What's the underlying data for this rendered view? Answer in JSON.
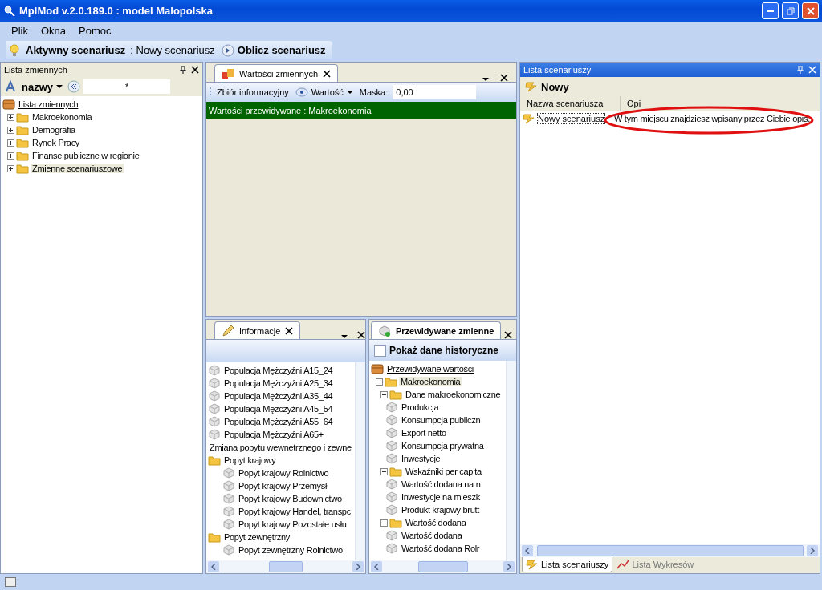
{
  "window": {
    "title": "MplMod v.2.0.189.0 : model Malopolska"
  },
  "menu": [
    "Plik",
    "Okna",
    "Pomoc"
  ],
  "toolbar": {
    "active_label": "Aktywny scenariusz",
    "active_value": ": Nowy scenariusz",
    "compute_button": "Oblicz scenariusz"
  },
  "variables_panel": {
    "title": "Lista zmiennych",
    "sort_button": "nazwy",
    "filter": "*",
    "tree": [
      {
        "kind": "root",
        "label": "Lista zmiennych",
        "selected": false,
        "children": [
          {
            "kind": "folder",
            "label": "Makroekonomia",
            "expanded": false,
            "selected": false
          },
          {
            "kind": "folder",
            "label": "Demografia",
            "expanded": false,
            "selected": false
          },
          {
            "kind": "folder",
            "label": "Rynek Pracy",
            "expanded": false,
            "selected": false
          },
          {
            "kind": "folder",
            "label": "Finanse publiczne w regionie",
            "expanded": false,
            "selected": false
          },
          {
            "kind": "folder",
            "label": "Zmienne scenariuszowe",
            "expanded": false,
            "selected": true
          }
        ]
      }
    ]
  },
  "values_panel": {
    "tabs": [
      {
        "label": "Wartości zmiennych",
        "selected": true
      }
    ],
    "set_label": "Zbiór informacyjny",
    "value_button": "Wartość",
    "mask_label": "Maska:",
    "mask_value": "0,00",
    "header": "Wartości przewidywane : Makroekonomia"
  },
  "info_panel": {
    "tabs": [
      {
        "label": "Informacje",
        "selected": true
      }
    ],
    "tree": [
      {
        "kind": "leaf",
        "label": "Populacja Mężczyźni A15_24",
        "selected": false
      },
      {
        "kind": "leaf",
        "label": "Populacja Mężczyźni A25_34",
        "selected": false
      },
      {
        "kind": "leaf",
        "label": "Populacja Mężczyźni A35_44",
        "selected": false
      },
      {
        "kind": "leaf",
        "label": "Populacja Mężczyźni A45_54",
        "selected": false
      },
      {
        "kind": "leaf",
        "label": "Populacja Mężczyźni A55_64",
        "selected": false
      },
      {
        "kind": "leaf",
        "label": "Populacja Mężczyźni A65+",
        "selected": false
      },
      {
        "kind": "text",
        "label": "Zmiana popytu wewnetrznego i zewne",
        "selected": false
      },
      {
        "kind": "folder",
        "label": "Popyt krajowy",
        "selected": false,
        "children": [
          {
            "kind": "leaf",
            "label": "Popyt krajowy Rolnictwo",
            "selected": false
          },
          {
            "kind": "leaf",
            "label": "Popyt krajowy Przemysł",
            "selected": false
          },
          {
            "kind": "leaf",
            "label": "Popyt krajowy Budownictwo",
            "selected": false
          },
          {
            "kind": "leaf",
            "label": "Popyt krajowy Handel, transpc",
            "selected": false
          },
          {
            "kind": "leaf",
            "label": "Popyt krajowy Pozostałe usłu",
            "selected": false
          }
        ]
      },
      {
        "kind": "folder",
        "label": "Popyt zewnętrzny",
        "selected": false,
        "children": [
          {
            "kind": "leaf",
            "label": "Popyt zewnętrzny Rolnictwo",
            "selected": false
          }
        ]
      }
    ]
  },
  "forecast_panel": {
    "tabs": [
      {
        "label": "Przewidywane zmienne",
        "selected": true
      }
    ],
    "history_checkbox": {
      "label": "Pokaż dane historyczne",
      "checked": false
    },
    "tree": [
      {
        "kind": "root",
        "label": "Przewidywane wartości",
        "selected": false,
        "children": [
          {
            "kind": "folder",
            "label": "Makroekonomia",
            "expanded": true,
            "selected": true,
            "children": [
              {
                "kind": "folder",
                "label": "Dane makroekonomiczne",
                "expanded": true,
                "selected": false,
                "children": [
                  {
                    "kind": "leaf",
                    "label": "Produkcja",
                    "selected": false
                  },
                  {
                    "kind": "leaf",
                    "label": "Konsumpcja publiczn",
                    "selected": false
                  },
                  {
                    "kind": "leaf",
                    "label": "Export netto",
                    "selected": false
                  },
                  {
                    "kind": "leaf",
                    "label": "Konsumpcja prywatna",
                    "selected": false
                  },
                  {
                    "kind": "leaf",
                    "label": "Inwestycje",
                    "selected": false
                  }
                ]
              },
              {
                "kind": "folder",
                "label": "Wskaźniki per capita",
                "expanded": true,
                "selected": false,
                "children": [
                  {
                    "kind": "leaf",
                    "label": "Wartość dodana na n",
                    "selected": false
                  },
                  {
                    "kind": "leaf",
                    "label": "Inwestycje na mieszk",
                    "selected": false
                  },
                  {
                    "kind": "leaf",
                    "label": "Produkt krajowy brutt",
                    "selected": false
                  }
                ]
              },
              {
                "kind": "folder",
                "label": "Wartość dodana",
                "expanded": true,
                "selected": false,
                "children": [
                  {
                    "kind": "leaf",
                    "label": "Wartość dodana",
                    "selected": false
                  },
                  {
                    "kind": "leaf",
                    "label": "Wartość dodana Rolr",
                    "selected": false
                  }
                ]
              }
            ]
          }
        ]
      }
    ]
  },
  "scenarios_panel": {
    "title": "Lista scenariuszy",
    "new_button": "Nowy",
    "columns": [
      "Nazwa scenariusza",
      "Opi"
    ],
    "rows": [
      {
        "name": "Nowy scenariusz",
        "description": "W tym miejscu znajdziesz wpisany przez Ciebie opis..",
        "selected": true
      }
    ],
    "bottom_tabs": [
      {
        "label": "Lista scenariuszy",
        "selected": true
      },
      {
        "label": "Lista Wykresów",
        "selected": false
      }
    ]
  }
}
